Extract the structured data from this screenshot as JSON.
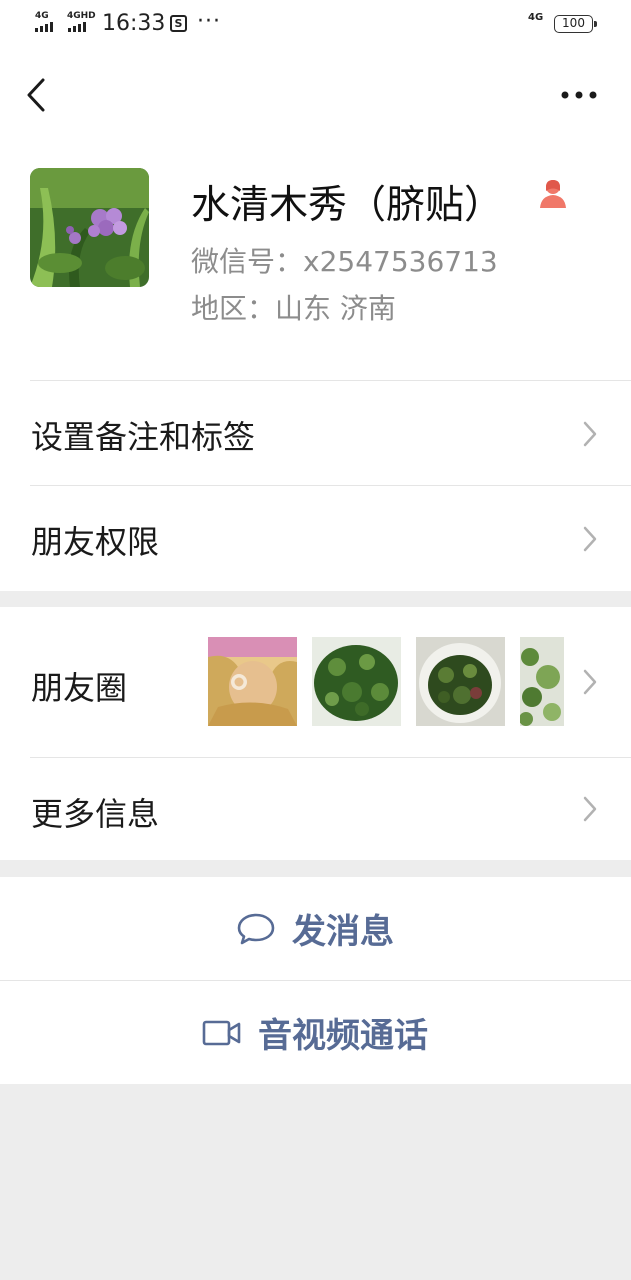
{
  "status_bar": {
    "sig1": "4G",
    "sig2": "4GHD",
    "time": "16:33",
    "sync_icon_label": "S",
    "dots": "···",
    "net": "4G",
    "battery": "100"
  },
  "profile": {
    "name": "水清木秀（脐贴）",
    "wechat_id": "微信号：x2547536713",
    "region": "地区：山东  济南"
  },
  "menu": {
    "remark_label": "设置备注和标签",
    "permissions_label": "朋友权限",
    "moments_label": "朋友圈",
    "more_info_label": "更多信息"
  },
  "actions": {
    "message_label": "发消息",
    "call_label": "音视频通话"
  },
  "colors": {
    "link_blue": "#576b95",
    "gender_female": "#f07869",
    "page_bg": "#ededed"
  },
  "icons": [
    "back-icon",
    "more-icon",
    "female-icon",
    "chevron-right-icon",
    "chat-bubble-icon",
    "video-camera-icon"
  ]
}
